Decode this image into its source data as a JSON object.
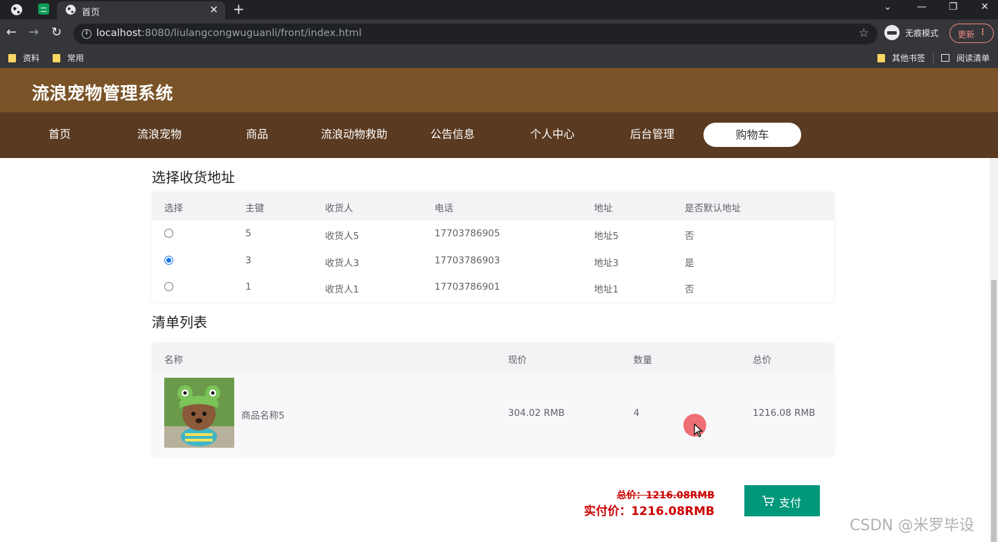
{
  "browser": {
    "tab_title": "首页",
    "url_host": "localhost",
    "url_rest": ":8080/liulangcongwuguanli/front/index.html",
    "incognito_label": "无痕模式",
    "update_label": "更新",
    "bookmarks": [
      "资料",
      "常用"
    ],
    "other_bookmarks": "其他书签",
    "reading_list": "阅读清单"
  },
  "site": {
    "title": "流浪宠物管理系统",
    "nav": [
      "首页",
      "流浪宠物",
      "商品",
      "流浪动物救助",
      "公告信息",
      "个人中心",
      "后台管理",
      "购物车"
    ],
    "active_nav": "购物车"
  },
  "address_section": {
    "title": "选择收货地址",
    "headers": [
      "选择",
      "主键",
      "收货人",
      "电话",
      "地址",
      "是否默认地址"
    ],
    "rows": [
      {
        "selected": false,
        "id": "5",
        "receiver": "收货人5",
        "phone": "17703786905",
        "address": "地址5",
        "default": "否"
      },
      {
        "selected": true,
        "id": "3",
        "receiver": "收货人3",
        "phone": "17703786903",
        "address": "地址3",
        "default": "是"
      },
      {
        "selected": false,
        "id": "1",
        "receiver": "收货人1",
        "phone": "17703786901",
        "address": "地址1",
        "default": "否"
      }
    ]
  },
  "order_section": {
    "title": "清单列表",
    "headers": [
      "名称",
      "现价",
      "数量",
      "总价"
    ],
    "items": [
      {
        "name": "商品名称5",
        "price": "304.02 RMB",
        "quantity": "4",
        "total": "1216.08 RMB"
      }
    ]
  },
  "summary": {
    "total_label": "总价：1216.08RMB",
    "actual_label": "实付价：1216.08RMB",
    "pay_button": "支付"
  },
  "watermark": "CSDN @米罗毕设",
  "colors": {
    "header": "#7a5328",
    "nav": "#5a3a20",
    "pay_button": "#00977a",
    "price": "#cc0000"
  }
}
